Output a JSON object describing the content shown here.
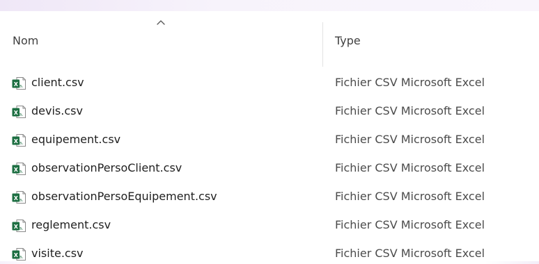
{
  "columns": {
    "name": "Nom",
    "type": "Type"
  },
  "sort": {
    "icon": "chevron-up-icon"
  },
  "files": [
    {
      "name": "client.csv",
      "type": "Fichier CSV Microsoft Excel",
      "icon": "excel-csv-file-icon"
    },
    {
      "name": "devis.csv",
      "type": "Fichier CSV Microsoft Excel",
      "icon": "excel-csv-file-icon"
    },
    {
      "name": "equipement.csv",
      "type": "Fichier CSV Microsoft Excel",
      "icon": "excel-csv-file-icon"
    },
    {
      "name": "observationPersoClient.csv",
      "type": "Fichier CSV Microsoft Excel",
      "icon": "excel-csv-file-icon"
    },
    {
      "name": "observationPersoEquipement.csv",
      "type": "Fichier CSV Microsoft Excel",
      "icon": "excel-csv-file-icon"
    },
    {
      "name": "reglement.csv",
      "type": "Fichier CSV Microsoft Excel",
      "icon": "excel-csv-file-icon"
    },
    {
      "name": "visite.csv",
      "type": "Fichier CSV Microsoft Excel",
      "icon": "excel-csv-file-icon"
    }
  ]
}
